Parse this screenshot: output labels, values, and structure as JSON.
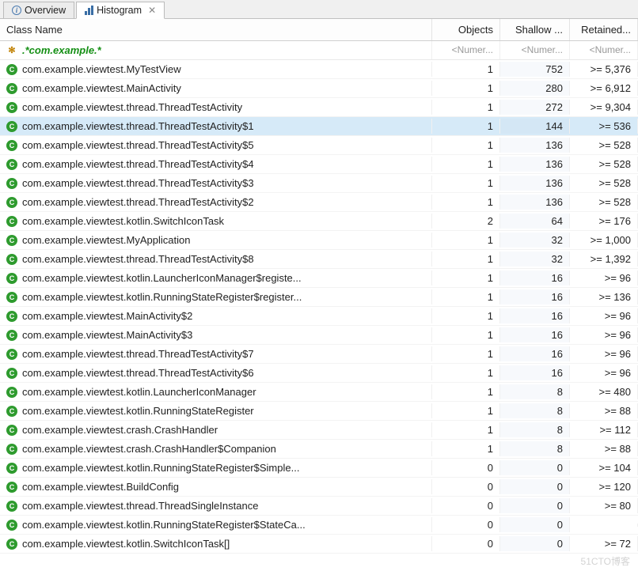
{
  "tabs": {
    "overview": "Overview",
    "histogram": "Histogram",
    "close": "✕"
  },
  "headers": {
    "class": "Class Name",
    "objects": "Objects",
    "shallow": "Shallow ...",
    "retained": "Retained..."
  },
  "filter": {
    "query": ".*com.example.*",
    "numeric": "<Numer..."
  },
  "rows": [
    {
      "name": "com.example.viewtest.MyTestView",
      "obj": "1",
      "sh": "752",
      "ret": ">= 5,376",
      "sel": false
    },
    {
      "name": "com.example.viewtest.MainActivity",
      "obj": "1",
      "sh": "280",
      "ret": ">= 6,912",
      "sel": false
    },
    {
      "name": "com.example.viewtest.thread.ThreadTestActivity",
      "obj": "1",
      "sh": "272",
      "ret": ">= 9,304",
      "sel": false
    },
    {
      "name": "com.example.viewtest.thread.ThreadTestActivity$1",
      "obj": "1",
      "sh": "144",
      "ret": ">= 536",
      "sel": true
    },
    {
      "name": "com.example.viewtest.thread.ThreadTestActivity$5",
      "obj": "1",
      "sh": "136",
      "ret": ">= 528",
      "sel": false
    },
    {
      "name": "com.example.viewtest.thread.ThreadTestActivity$4",
      "obj": "1",
      "sh": "136",
      "ret": ">= 528",
      "sel": false
    },
    {
      "name": "com.example.viewtest.thread.ThreadTestActivity$3",
      "obj": "1",
      "sh": "136",
      "ret": ">= 528",
      "sel": false
    },
    {
      "name": "com.example.viewtest.thread.ThreadTestActivity$2",
      "obj": "1",
      "sh": "136",
      "ret": ">= 528",
      "sel": false
    },
    {
      "name": "com.example.viewtest.kotlin.SwitchIconTask",
      "obj": "2",
      "sh": "64",
      "ret": ">= 176",
      "sel": false
    },
    {
      "name": "com.example.viewtest.MyApplication",
      "obj": "1",
      "sh": "32",
      "ret": ">= 1,000",
      "sel": false
    },
    {
      "name": "com.example.viewtest.thread.ThreadTestActivity$8",
      "obj": "1",
      "sh": "32",
      "ret": ">= 1,392",
      "sel": false
    },
    {
      "name": "com.example.viewtest.kotlin.LauncherIconManager$registe...",
      "obj": "1",
      "sh": "16",
      "ret": ">= 96",
      "sel": false
    },
    {
      "name": "com.example.viewtest.kotlin.RunningStateRegister$register...",
      "obj": "1",
      "sh": "16",
      "ret": ">= 136",
      "sel": false
    },
    {
      "name": "com.example.viewtest.MainActivity$2",
      "obj": "1",
      "sh": "16",
      "ret": ">= 96",
      "sel": false
    },
    {
      "name": "com.example.viewtest.MainActivity$3",
      "obj": "1",
      "sh": "16",
      "ret": ">= 96",
      "sel": false
    },
    {
      "name": "com.example.viewtest.thread.ThreadTestActivity$7",
      "obj": "1",
      "sh": "16",
      "ret": ">= 96",
      "sel": false
    },
    {
      "name": "com.example.viewtest.thread.ThreadTestActivity$6",
      "obj": "1",
      "sh": "16",
      "ret": ">= 96",
      "sel": false
    },
    {
      "name": "com.example.viewtest.kotlin.LauncherIconManager",
      "obj": "1",
      "sh": "8",
      "ret": ">= 480",
      "sel": false
    },
    {
      "name": "com.example.viewtest.kotlin.RunningStateRegister",
      "obj": "1",
      "sh": "8",
      "ret": ">= 88",
      "sel": false
    },
    {
      "name": "com.example.viewtest.crash.CrashHandler",
      "obj": "1",
      "sh": "8",
      "ret": ">= 112",
      "sel": false
    },
    {
      "name": "com.example.viewtest.crash.CrashHandler$Companion",
      "obj": "1",
      "sh": "8",
      "ret": ">= 88",
      "sel": false
    },
    {
      "name": "com.example.viewtest.kotlin.RunningStateRegister$Simple...",
      "obj": "0",
      "sh": "0",
      "ret": ">= 104",
      "sel": false
    },
    {
      "name": "com.example.viewtest.BuildConfig",
      "obj": "0",
      "sh": "0",
      "ret": ">= 120",
      "sel": false
    },
    {
      "name": "com.example.viewtest.thread.ThreadSingleInstance",
      "obj": "0",
      "sh": "0",
      "ret": ">= 80",
      "sel": false
    },
    {
      "name": "com.example.viewtest.kotlin.RunningStateRegister$StateCa...",
      "obj": "0",
      "sh": "0",
      "ret": "",
      "sel": false
    },
    {
      "name": "com.example.viewtest.kotlin.SwitchIconTask[]",
      "obj": "0",
      "sh": "0",
      "ret": ">= 72",
      "sel": false
    }
  ],
  "watermark": "51CTO博客"
}
